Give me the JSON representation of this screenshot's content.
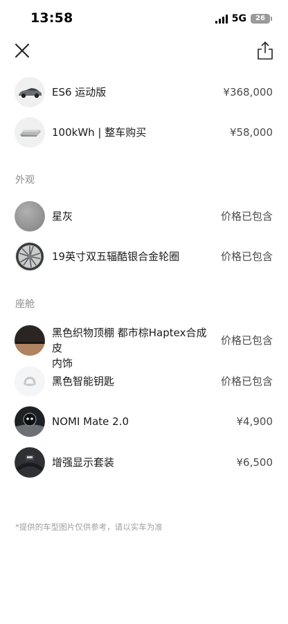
{
  "status": {
    "time": "13:58",
    "network": "5G",
    "battery": "26"
  },
  "icons": {
    "close": "close-icon",
    "share": "share-icon"
  },
  "car": [
    {
      "label": "ES6 运动版",
      "price": "¥368,000",
      "icon": "car-thumbnail"
    },
    {
      "label": "100kWh | 整车购买",
      "price": "¥58,000",
      "icon": "battery-pack-thumbnail"
    }
  ],
  "exterior": {
    "title": "外观",
    "items": [
      {
        "label": "星灰",
        "price": "价格已包含",
        "color": "#9b9b9b"
      },
      {
        "label": "19英寸双五辐酷银合金轮圈",
        "price": "价格已包含",
        "icon": "wheel-thumbnail"
      }
    ]
  },
  "interior": {
    "title": "座舱",
    "items": [
      {
        "label_line1": "黑色织物顶棚 都市棕Haptex合成皮",
        "label_line2": "内饰",
        "price": "价格已包含"
      },
      {
        "label": "黑色智能钥匙",
        "price": "价格已包含"
      },
      {
        "label": "NOMI Mate 2.0",
        "price": "¥4,900"
      },
      {
        "label": "增强显示套装",
        "price": "¥6,500"
      }
    ]
  },
  "footnote": "*提供的车型图片仅供参考，请以实车为准"
}
